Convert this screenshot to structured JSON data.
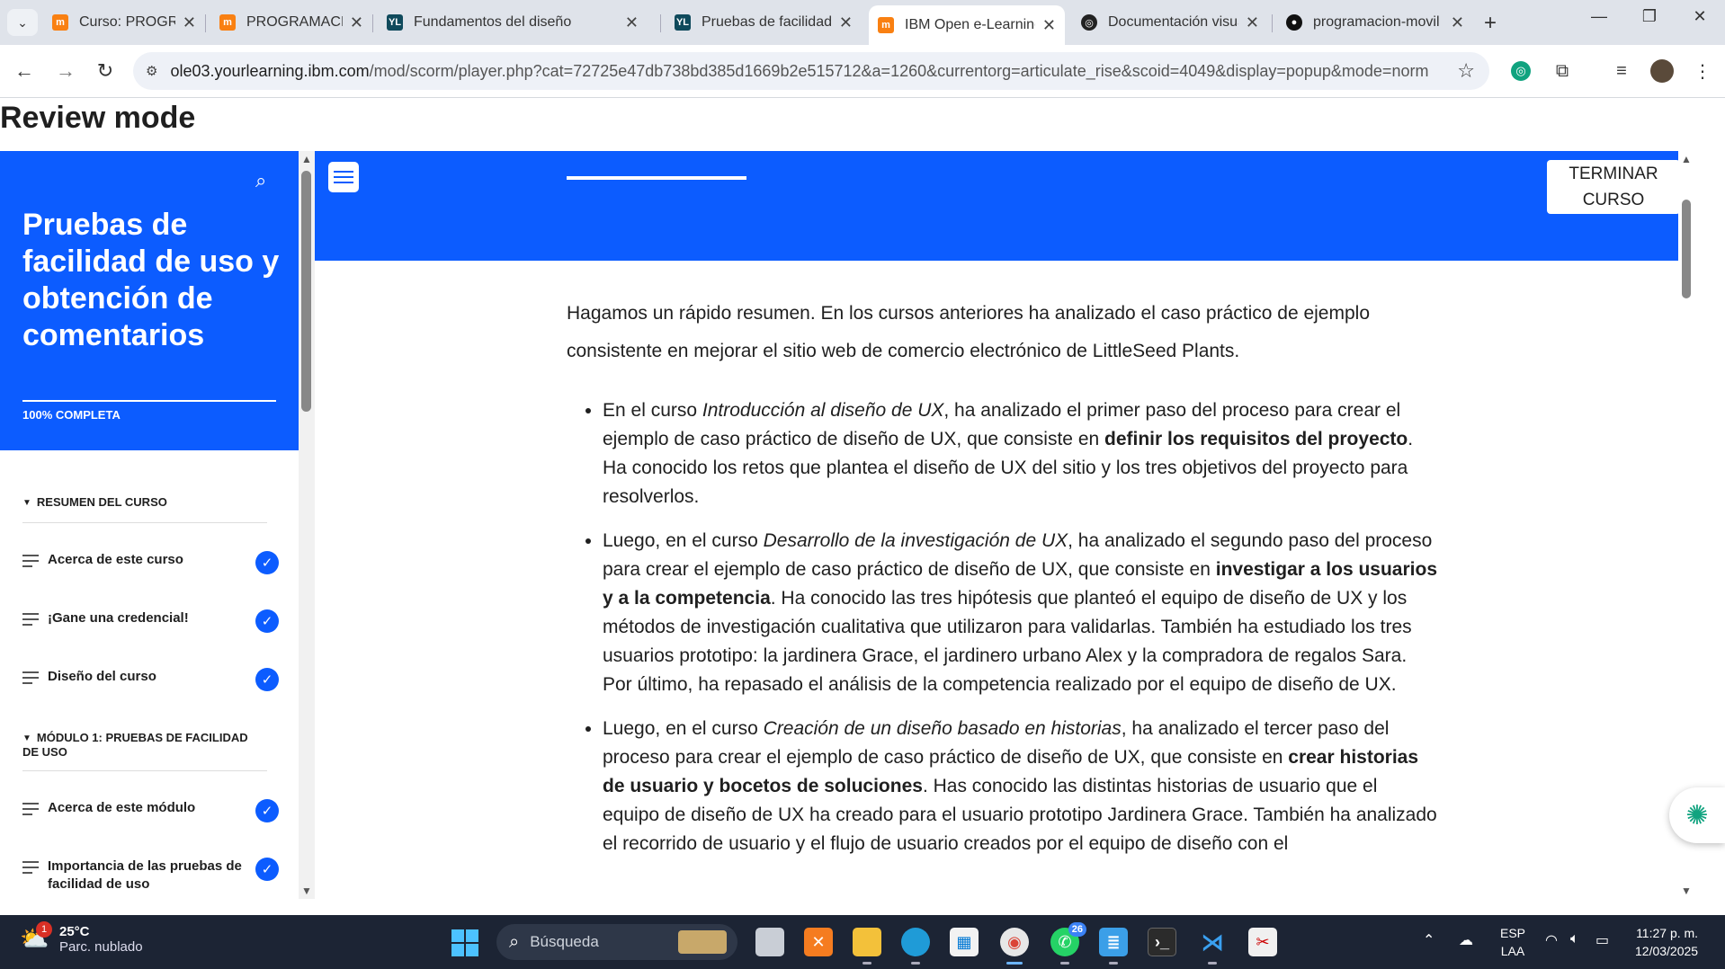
{
  "browser": {
    "tabs": [
      {
        "title": "Curso: PROGRAMACIÓN",
        "favicon": "moodle-icon",
        "active": false
      },
      {
        "title": "PROGRAMACION MOVIL",
        "favicon": "moodle-icon",
        "active": false
      },
      {
        "title": "Fundamentos del diseño",
        "favicon": "yourlearning-icon",
        "active": false
      },
      {
        "title": "Pruebas de facilidad de uso",
        "favicon": "yourlearning-icon",
        "active": false
      },
      {
        "title": "IBM Open e-Learning",
        "favicon": "moodle-icon",
        "active": true
      },
      {
        "title": "Documentación visual",
        "favicon": "openai-icon",
        "active": false
      },
      {
        "title": "programacion-movil",
        "favicon": "github-icon",
        "active": false
      }
    ],
    "url_host": "ole03.yourlearning.ibm.com",
    "url_path": "/mod/scorm/player.php?cat=72725e47db738bd385d1669b2e515712&a=1260&currentorg=articulate_rise&scoid=4049&display=popup&mode=norma..."
  },
  "page": {
    "heading": "Review mode"
  },
  "sidebar": {
    "course_title": "Pruebas de facilidad de uso y obtención de comentarios",
    "progress_label": "100% COMPLETA",
    "section1": "RESUMEN DEL CURSO",
    "section2": "MÓDULO 1: PRUEBAS DE FACILIDAD DE USO",
    "items": [
      {
        "label": "Acerca de este curso"
      },
      {
        "label": "¡Gane una credencial!"
      },
      {
        "label": "Diseño del curso"
      },
      {
        "label": "Acerca de este módulo"
      },
      {
        "label": "Importancia de las pruebas de facilidad de uso"
      }
    ]
  },
  "topbar": {
    "finish_line1": "TERMINAR",
    "finish_line2": "CURSO"
  },
  "lesson": {
    "intro": "Hagamos un rápido resumen. En los cursos anteriores ha analizado el caso práctico de ejemplo consistente en mejorar el sitio web de comercio electrónico de LittleSeed Plants.",
    "b1_a": "En el curso ",
    "b1_em": "Introducción al diseño de UX",
    "b1_b": ", ha analizado el primer paso del proceso para crear el ejemplo de caso práctico de diseño de UX, que consiste en ",
    "b1_strong": "definir los requisitos del proyecto",
    "b1_c": ". Ha conocido los retos que plantea el diseño de UX del sitio y los tres objetivos del proyecto para resolverlos.",
    "b2_a": "Luego, en el curso ",
    "b2_em": "Desarrollo de la investigación de UX",
    "b2_b": ", ha analizado el segundo paso del proceso para crear el ejemplo de caso práctico de diseño de UX, que consiste en ",
    "b2_strong": "investigar a los usuarios y a la competencia",
    "b2_c": ". Ha conocido las tres hipótesis que planteó el equipo de diseño de UX y los métodos de investigación cualitativa que utilizaron para validarlas. También ha estudiado los tres usuarios prototipo: la jardinera Grace, el jardinero urbano Alex y la compradora de regalos Sara. Por último, ha repasado el análisis de la competencia realizado por el equipo de diseño de UX.",
    "b3_a": "Luego, en el curso ",
    "b3_em": "Creación de un diseño basado en historias",
    "b3_b": ", ha analizado el tercer paso del proceso para crear el ejemplo de caso práctico de diseño de UX, que consiste en ",
    "b3_strong": "crear historias de usuario y bocetos de soluciones",
    "b3_c": ". Has conocido las distintas historias de usuario que el equipo de diseño de UX ha creado para el usuario prototipo Jardinera Grace. También ha analizado el recorrido de usuario y el flujo de usuario creados por el equipo de diseño con el"
  },
  "taskbar": {
    "temperature": "25°C",
    "weather": "Parc. nublado",
    "weather_badge": "1",
    "search_placeholder": "Búsqueda",
    "whatsapp_count": "26",
    "lang1": "ESP",
    "lang2": "LAA",
    "time": "11:27 p. m.",
    "date": "12/03/2025"
  },
  "colors": {
    "accent": "#0c5cff",
    "taskbar": "#1c2434"
  }
}
